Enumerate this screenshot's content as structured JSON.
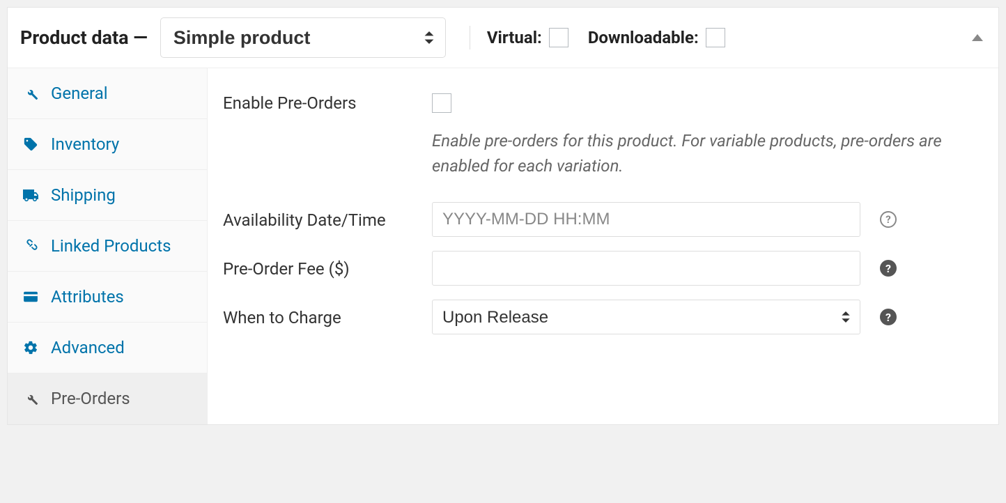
{
  "header": {
    "title": "Product data —",
    "product_type": "Simple product",
    "virtual_label": "Virtual:",
    "downloadable_label": "Downloadable:"
  },
  "tabs": [
    {
      "key": "general",
      "label": "General",
      "icon": "wrench-icon",
      "active": false
    },
    {
      "key": "inventory",
      "label": "Inventory",
      "icon": "tag-icon",
      "active": false
    },
    {
      "key": "shipping",
      "label": "Shipping",
      "icon": "truck-icon",
      "active": false
    },
    {
      "key": "linked",
      "label": "Linked Products",
      "icon": "link-icon",
      "active": false
    },
    {
      "key": "attributes",
      "label": "Attributes",
      "icon": "card-icon",
      "active": false
    },
    {
      "key": "advanced",
      "label": "Advanced",
      "icon": "gear-icon",
      "active": false
    },
    {
      "key": "preorders",
      "label": "Pre-Orders",
      "icon": "wrench-icon",
      "active": true
    }
  ],
  "form": {
    "enable_label": "Enable Pre-Orders",
    "enable_desc": "Enable pre-orders for this product. For variable products, pre-orders are enabled for each variation.",
    "availability_label": "Availability Date/Time",
    "availability_placeholder": "YYYY-MM-DD HH:MM",
    "fee_label": "Pre-Order Fee ($)",
    "charge_label": "When to Charge",
    "charge_value": "Upon Release"
  }
}
